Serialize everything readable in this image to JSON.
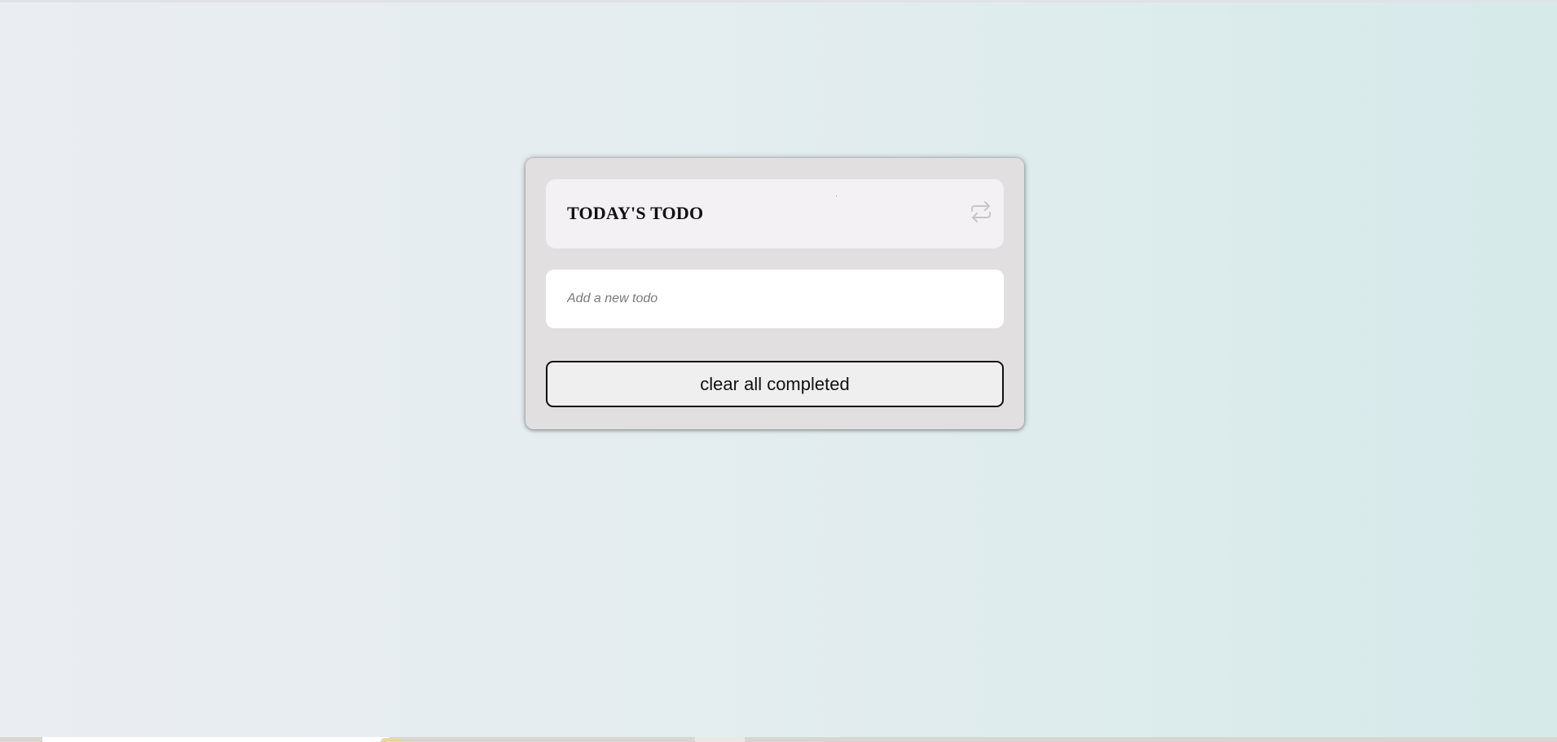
{
  "app": {
    "title": "TODAY'S TODO"
  },
  "header": {
    "title": "TODAY'S TODO",
    "toggle_icon": "repeat-icon"
  },
  "new_todo": {
    "value": "",
    "placeholder": "Add a new todo"
  },
  "actions": {
    "clear_completed_label": "clear all completed"
  },
  "colors": {
    "card_background": "#e1dfe0",
    "header_background": "#f3f1f3",
    "input_background": "#ffffff",
    "button_background": "#efefef",
    "button_border": "#111111",
    "page_gradient_start": "#eaedf2",
    "page_gradient_end": "#d6eaea"
  }
}
